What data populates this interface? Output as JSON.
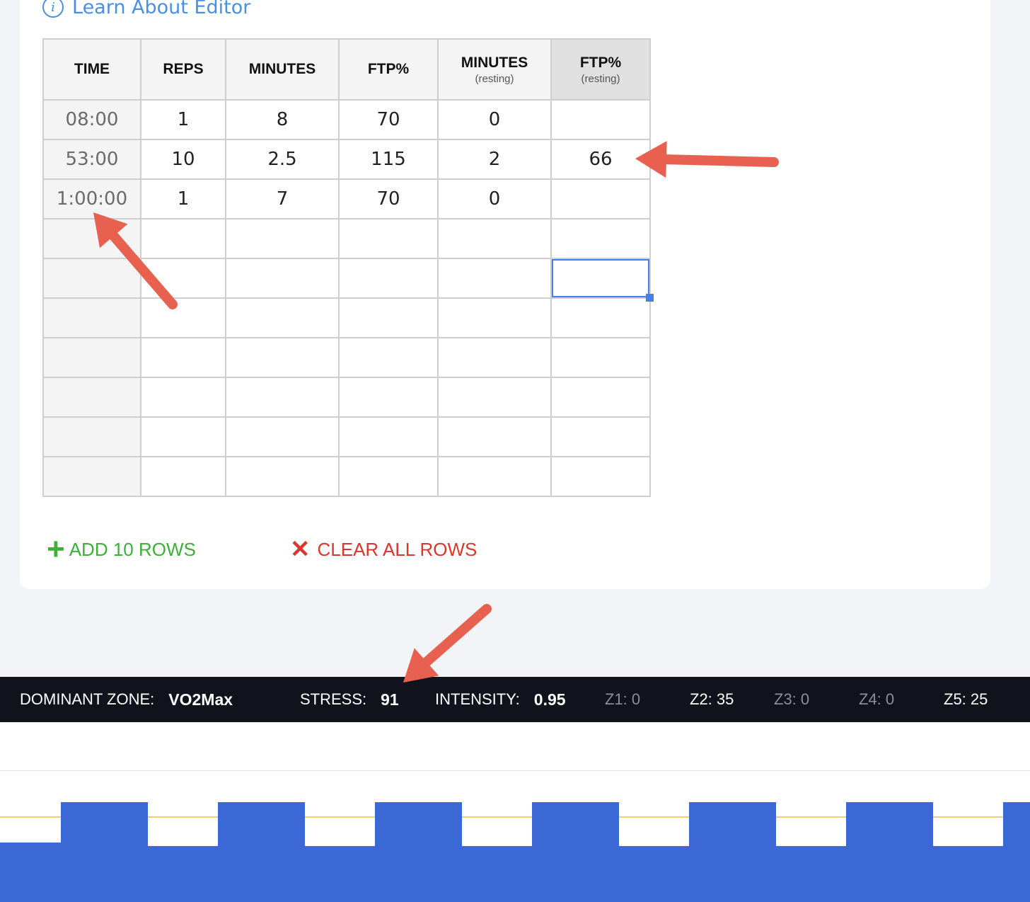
{
  "learn_link": "Learn About Editor",
  "table": {
    "headers": [
      {
        "label": "TIME",
        "sub": ""
      },
      {
        "label": "REPS",
        "sub": ""
      },
      {
        "label": "MINUTES",
        "sub": ""
      },
      {
        "label": "FTP%",
        "sub": ""
      },
      {
        "label": "MINUTES",
        "sub": "(resting)"
      },
      {
        "label": "FTP%",
        "sub": "(resting)"
      }
    ],
    "rows": [
      [
        "08:00",
        "1",
        "8",
        "70",
        "0",
        ""
      ],
      [
        "53:00",
        "10",
        "2.5",
        "115",
        "2",
        "66"
      ],
      [
        "1:00:00",
        "1",
        "7",
        "70",
        "0",
        ""
      ],
      [
        "",
        "",
        "",
        "",
        "",
        ""
      ],
      [
        "",
        "",
        "",
        "",
        "",
        ""
      ],
      [
        "",
        "",
        "",
        "",
        "",
        ""
      ],
      [
        "",
        "",
        "",
        "",
        "",
        ""
      ],
      [
        "",
        "",
        "",
        "",
        "",
        ""
      ],
      [
        "",
        "",
        "",
        "",
        "",
        ""
      ],
      [
        "",
        "",
        "",
        "",
        "",
        ""
      ]
    ]
  },
  "actions": {
    "add_label": "ADD 10 ROWS",
    "clear_label": "CLEAR ALL ROWS"
  },
  "stats": {
    "dominant_label": "DOMINANT ZONE:",
    "dominant_value": "VO2Max",
    "stress_label": "STRESS:",
    "stress_value": "91",
    "intensity_label": "INTENSITY:",
    "intensity_value": "0.95",
    "z1": "Z1: 0",
    "z2": "Z2: 35",
    "z3": "Z3: 0",
    "z4": "Z4: 0",
    "z5": "Z5: 25"
  },
  "colors": {
    "bar_blue": "#3c68d6",
    "ftp_line": "#f5cd7a",
    "arrow": "#e8604f",
    "link_blue": "#4a90e2",
    "add_green": "#3fae3a",
    "clear_red": "#d9372b"
  }
}
